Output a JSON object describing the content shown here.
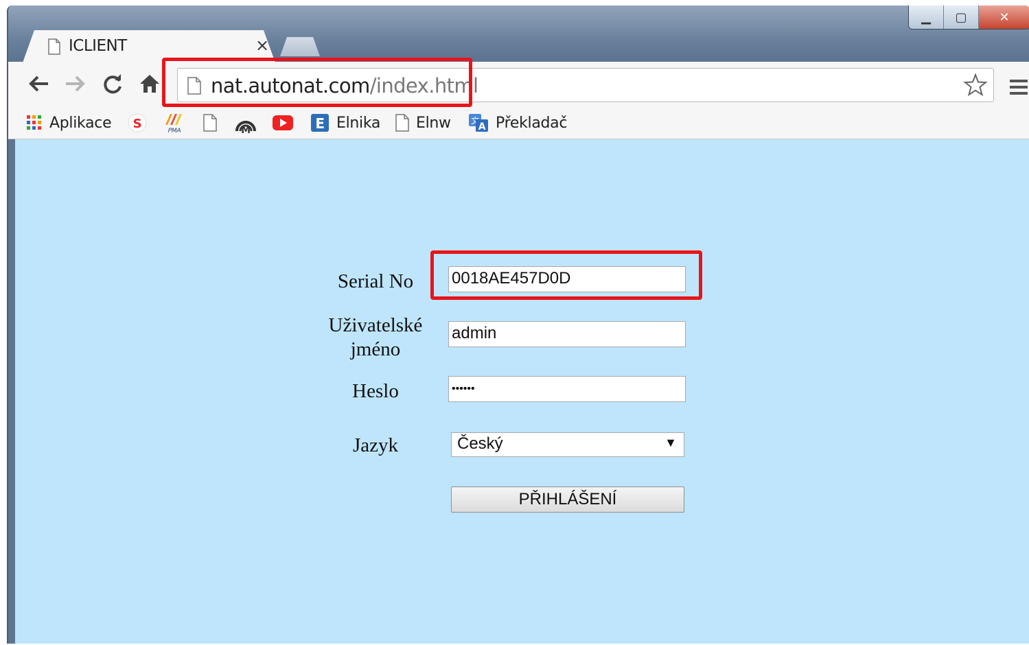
{
  "browser": {
    "tab": {
      "title": "ICLIENT",
      "close_glyph": "×"
    },
    "address": {
      "host": "nat.autonat.com",
      "path": "/index.html"
    },
    "window_controls": {
      "minimize": "▁",
      "maximize": "▢",
      "close": "✕"
    },
    "bookmarks": [
      {
        "label": "Aplikace",
        "icon": "apps-grid-icon"
      },
      {
        "label": "",
        "icon": "s-logo-icon"
      },
      {
        "label": "",
        "icon": "pma-logo-icon"
      },
      {
        "label": "",
        "icon": "page-icon"
      },
      {
        "label": "",
        "icon": "m-logo-icon"
      },
      {
        "label": "",
        "icon": "youtube-icon"
      },
      {
        "label": "Elnika",
        "icon": "e-logo-icon"
      },
      {
        "label": "Elnw",
        "icon": "page-icon"
      },
      {
        "label": "Překladač",
        "icon": "translate-icon"
      }
    ]
  },
  "login_form": {
    "serial_label": "Serial No",
    "serial_value": "0018AE457D0D",
    "username_label_line1": "Uživatelské",
    "username_label_line2": "jméno",
    "username_value": "admin",
    "password_label": "Heslo",
    "password_masked": "••••••",
    "language_label": "Jazyk",
    "language_value": "Český",
    "submit_label": "PŘIHLÁŠENÍ"
  },
  "colors": {
    "content_background": "#bee5fb",
    "highlight": "#e8141c"
  }
}
